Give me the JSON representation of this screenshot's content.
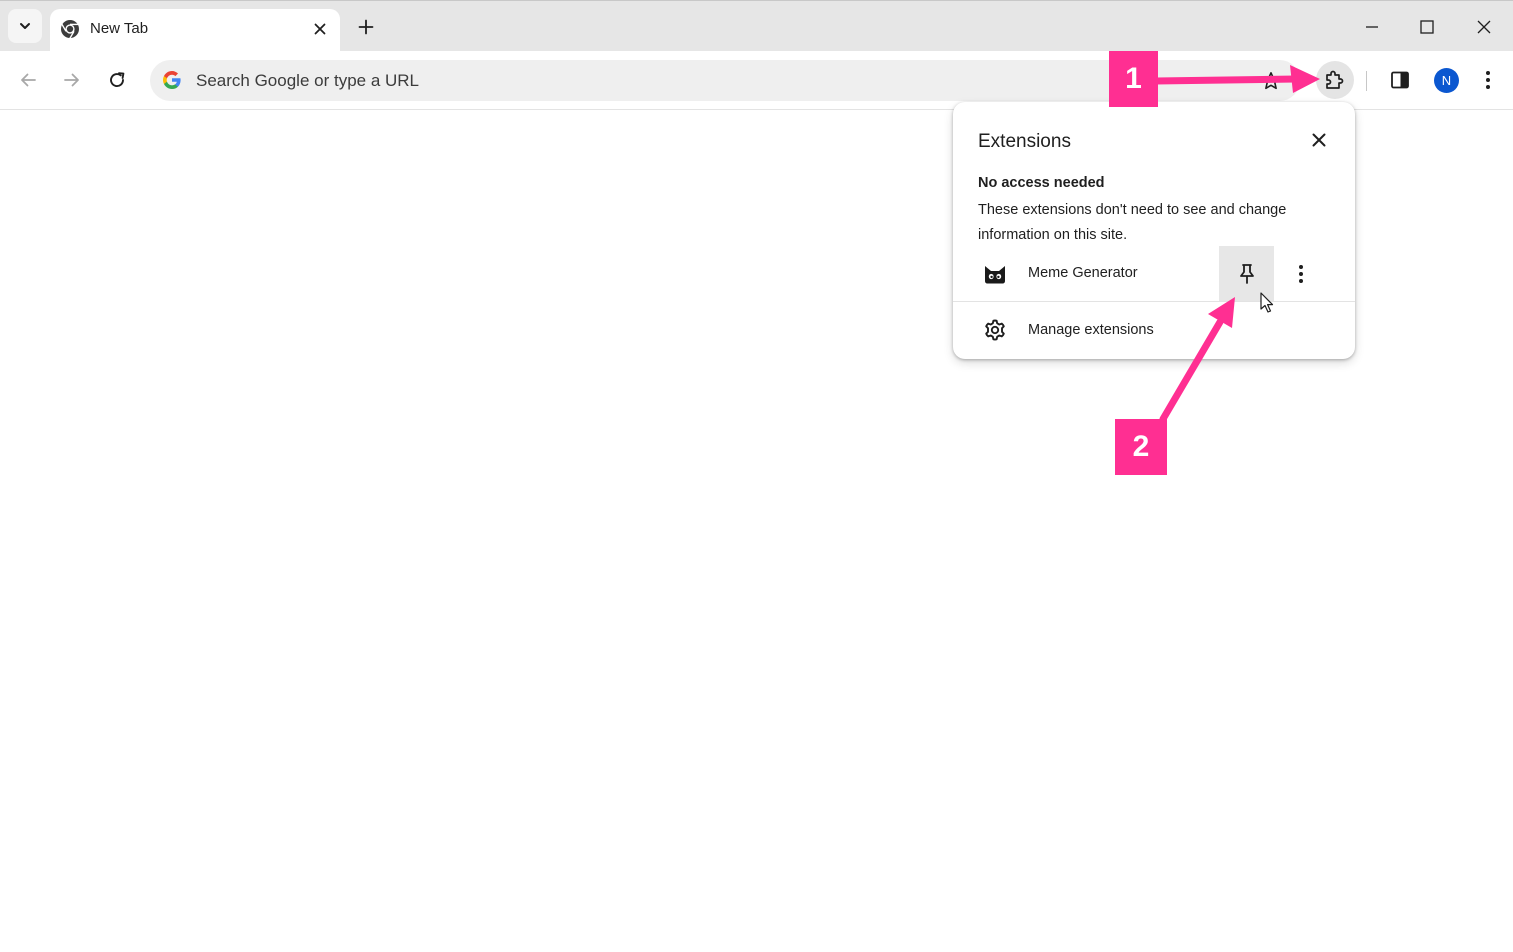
{
  "browser": {
    "tab": {
      "title": "New Tab"
    },
    "omnibox": {
      "placeholder": "Search Google or type a URL"
    },
    "profile": {
      "initial": "N"
    },
    "icons": {
      "tab_search": "chevron-down-icon",
      "tab_favicon": "chrome-icon",
      "tab_close": "close-icon",
      "new_tab": "plus-icon",
      "back": "arrow-left-icon",
      "forward": "arrow-right-icon",
      "reload": "reload-icon",
      "bookmark": "star-icon",
      "extensions": "puzzle-icon",
      "side_panel": "side-panel-icon",
      "menu": "kebab-icon"
    }
  },
  "extensions_popup": {
    "title": "Extensions",
    "section": {
      "heading": "No access needed",
      "description": "These extensions don't need to see and change information on this site."
    },
    "items": [
      {
        "name": "Meme Generator",
        "icon": "cat-mask-icon"
      }
    ],
    "manage_label": "Manage extensions"
  },
  "annotations": {
    "step_1": "1",
    "step_2": "2",
    "color": "#ff2f92"
  }
}
